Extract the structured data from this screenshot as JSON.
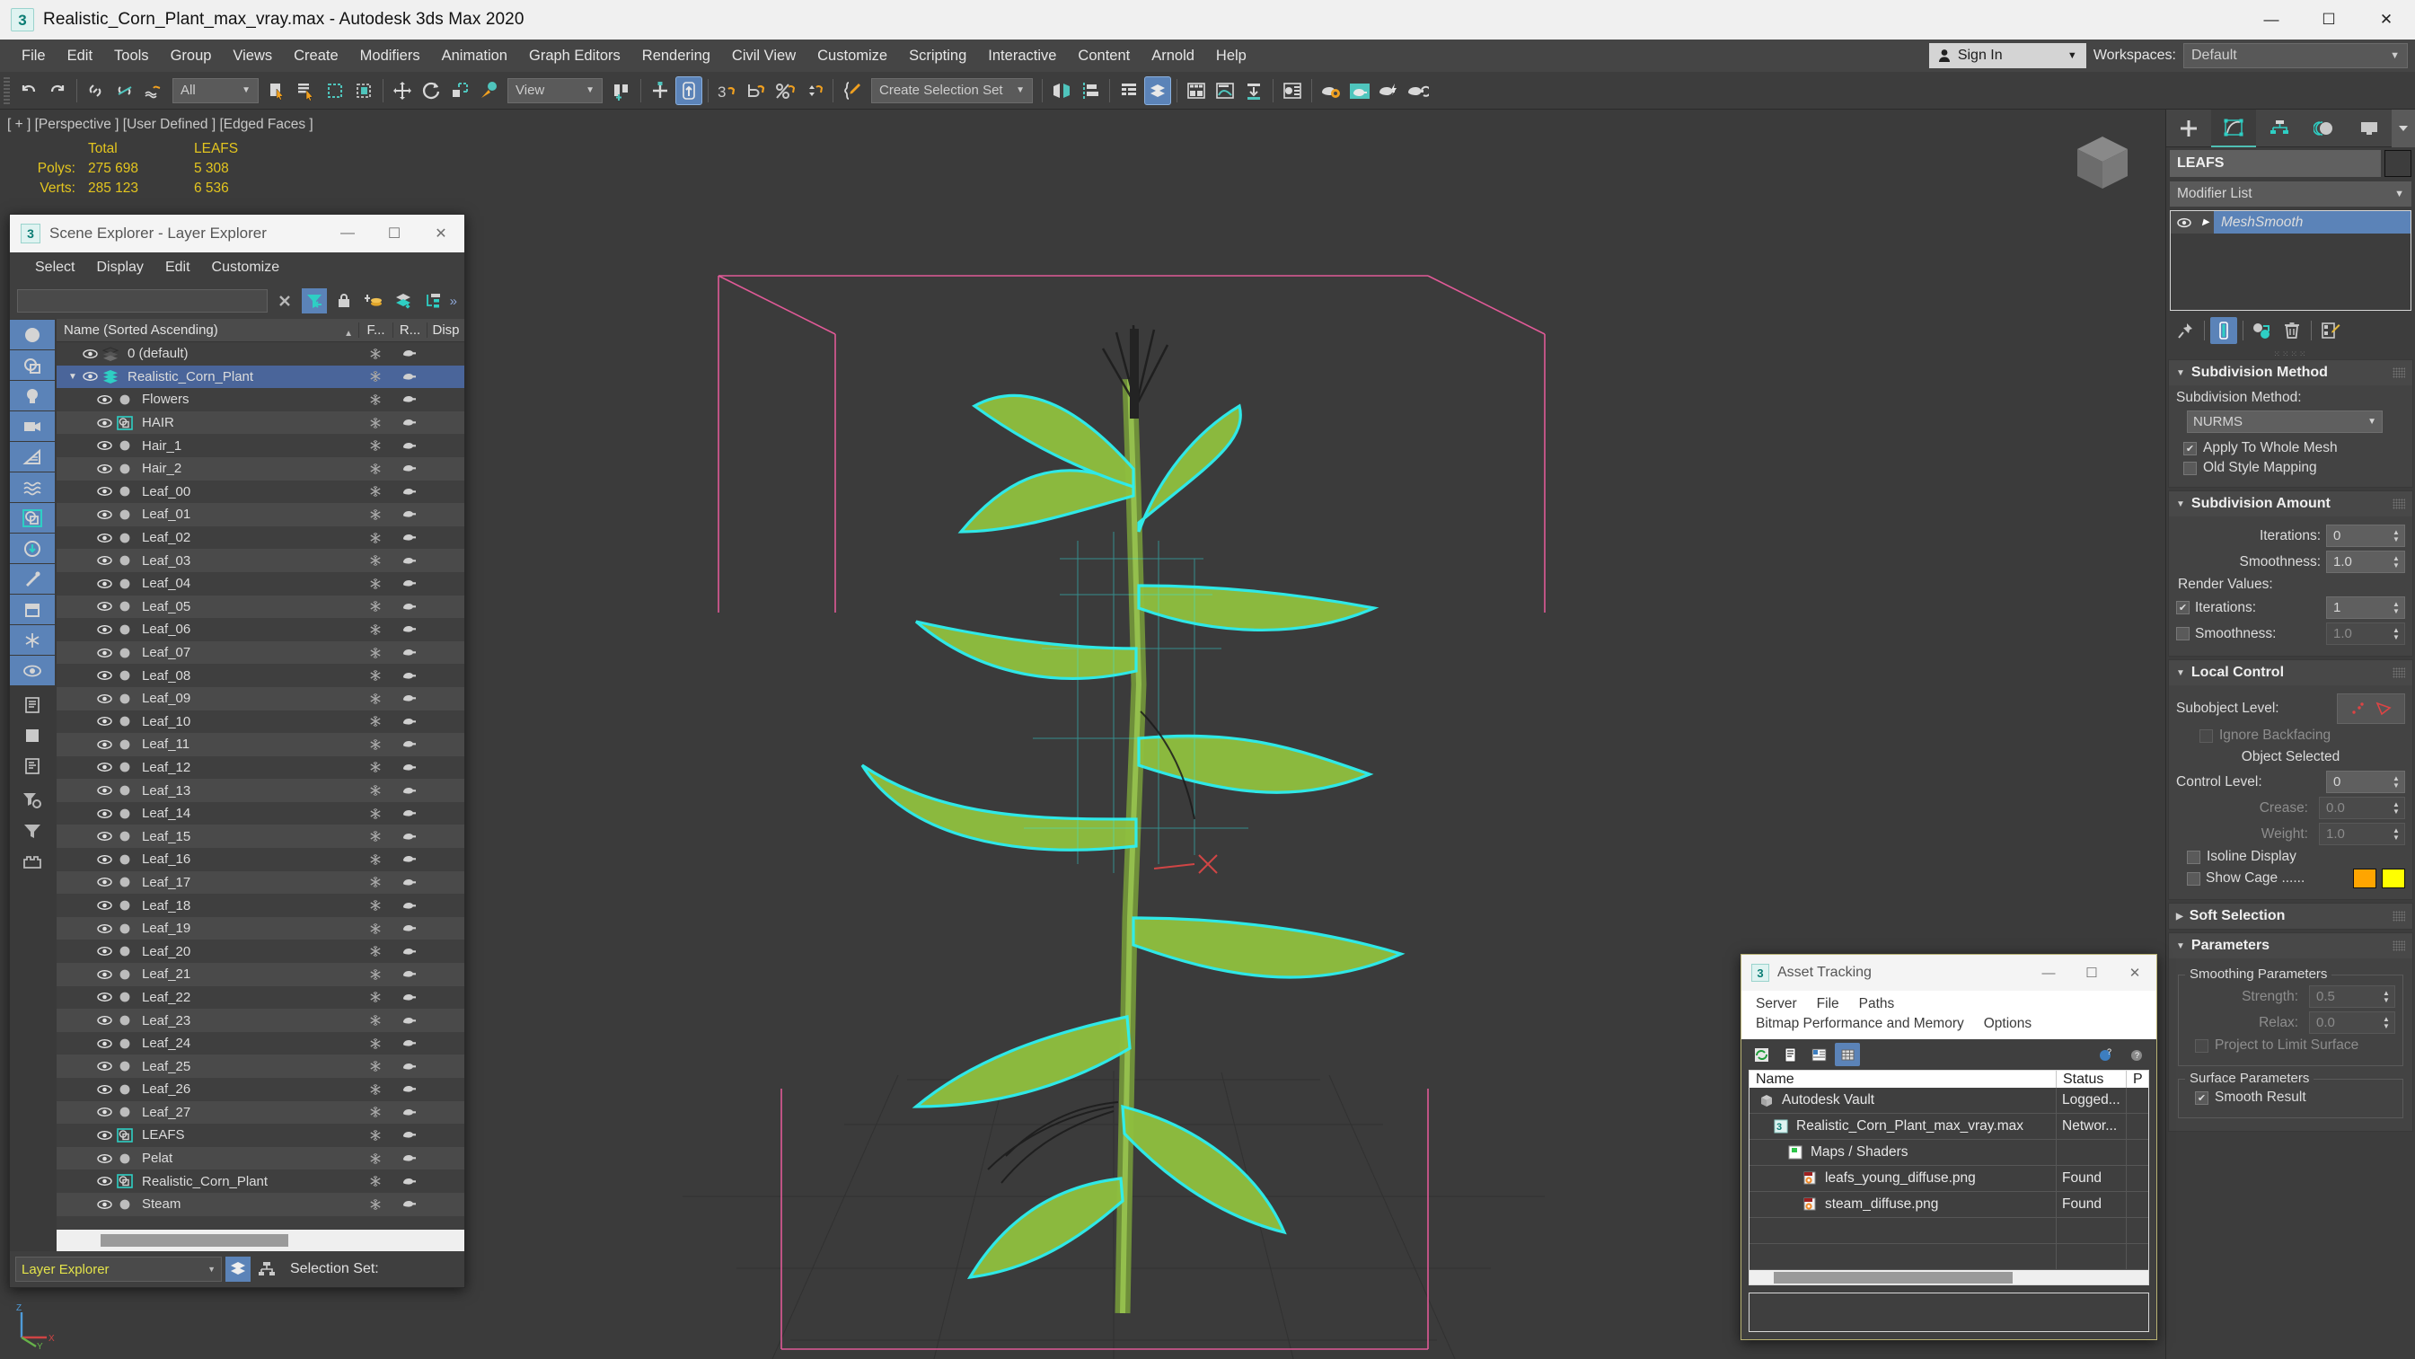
{
  "window": {
    "title": "Realistic_Corn_Plant_max_vray.max - Autodesk 3ds Max 2020",
    "app_icon": "3ds-max-icon",
    "minimize": "—",
    "maximize": "☐",
    "close": "✕"
  },
  "menubar": {
    "items": [
      "File",
      "Edit",
      "Tools",
      "Group",
      "Views",
      "Create",
      "Modifiers",
      "Animation",
      "Graph Editors",
      "Rendering",
      "Civil View",
      "Customize",
      "Scripting",
      "Interactive",
      "Content",
      "Arnold",
      "Help"
    ],
    "sign_in": "Sign In",
    "workspaces_label": "Workspaces:",
    "workspace_value": "Default",
    "caret": "▼"
  },
  "toolbar": {
    "selection_filter": "All",
    "reference_coord": "View",
    "selection_set": "Create Selection Set",
    "caret": "▼"
  },
  "viewport": {
    "label": "[ + ] [Perspective ] [User Defined ] [Edged Faces ]",
    "stats": {
      "col_total": "Total",
      "col_object": "LEAFS",
      "rows": [
        {
          "label": "Polys:",
          "total": "275 698",
          "object": "5 308"
        },
        {
          "label": "Verts:",
          "total": "285 123",
          "object": "6 536"
        }
      ]
    }
  },
  "scene_explorer": {
    "title": "Scene Explorer - Layer Explorer",
    "minimize": "—",
    "maximize": "☐",
    "close": "✕",
    "menus": [
      "Select",
      "Display",
      "Edit",
      "Customize"
    ],
    "search_value": "",
    "chevron": "»",
    "columns": {
      "name": "Name (Sorted Ascending)",
      "sort_arrow": "▲",
      "f": "F...",
      "r": "R...",
      "disp": "Disp"
    },
    "footer_combo": "Layer Explorer",
    "footer_selection_set": "Selection Set:",
    "rows": [
      {
        "name": "0 (default)",
        "indent": 1,
        "icon": "layers-icon",
        "selected": false,
        "expander": ""
      },
      {
        "name": "Realistic_Corn_Plant",
        "indent": 1,
        "icon": "layers-teal-icon",
        "selected": true,
        "expander": "▼"
      },
      {
        "name": "Flowers",
        "indent": 2,
        "icon": "sphere-icon",
        "selected": false,
        "expander": ""
      },
      {
        "name": "HAIR",
        "indent": 2,
        "icon": "group-icon",
        "selected": false,
        "expander": ""
      },
      {
        "name": "Hair_1",
        "indent": 2,
        "icon": "sphere-icon",
        "selected": false,
        "expander": ""
      },
      {
        "name": "Hair_2",
        "indent": 2,
        "icon": "sphere-icon",
        "selected": false,
        "expander": ""
      },
      {
        "name": "Leaf_00",
        "indent": 2,
        "icon": "sphere-icon",
        "selected": false,
        "expander": ""
      },
      {
        "name": "Leaf_01",
        "indent": 2,
        "icon": "sphere-icon",
        "selected": false,
        "expander": ""
      },
      {
        "name": "Leaf_02",
        "indent": 2,
        "icon": "sphere-icon",
        "selected": false,
        "expander": ""
      },
      {
        "name": "Leaf_03",
        "indent": 2,
        "icon": "sphere-icon",
        "selected": false,
        "expander": ""
      },
      {
        "name": "Leaf_04",
        "indent": 2,
        "icon": "sphere-icon",
        "selected": false,
        "expander": ""
      },
      {
        "name": "Leaf_05",
        "indent": 2,
        "icon": "sphere-icon",
        "selected": false,
        "expander": ""
      },
      {
        "name": "Leaf_06",
        "indent": 2,
        "icon": "sphere-icon",
        "selected": false,
        "expander": ""
      },
      {
        "name": "Leaf_07",
        "indent": 2,
        "icon": "sphere-icon",
        "selected": false,
        "expander": ""
      },
      {
        "name": "Leaf_08",
        "indent": 2,
        "icon": "sphere-icon",
        "selected": false,
        "expander": ""
      },
      {
        "name": "Leaf_09",
        "indent": 2,
        "icon": "sphere-icon",
        "selected": false,
        "expander": ""
      },
      {
        "name": "Leaf_10",
        "indent": 2,
        "icon": "sphere-icon",
        "selected": false,
        "expander": ""
      },
      {
        "name": "Leaf_11",
        "indent": 2,
        "icon": "sphere-icon",
        "selected": false,
        "expander": ""
      },
      {
        "name": "Leaf_12",
        "indent": 2,
        "icon": "sphere-icon",
        "selected": false,
        "expander": ""
      },
      {
        "name": "Leaf_13",
        "indent": 2,
        "icon": "sphere-icon",
        "selected": false,
        "expander": ""
      },
      {
        "name": "Leaf_14",
        "indent": 2,
        "icon": "sphere-icon",
        "selected": false,
        "expander": ""
      },
      {
        "name": "Leaf_15",
        "indent": 2,
        "icon": "sphere-icon",
        "selected": false,
        "expander": ""
      },
      {
        "name": "Leaf_16",
        "indent": 2,
        "icon": "sphere-icon",
        "selected": false,
        "expander": ""
      },
      {
        "name": "Leaf_17",
        "indent": 2,
        "icon": "sphere-icon",
        "selected": false,
        "expander": ""
      },
      {
        "name": "Leaf_18",
        "indent": 2,
        "icon": "sphere-icon",
        "selected": false,
        "expander": ""
      },
      {
        "name": "Leaf_19",
        "indent": 2,
        "icon": "sphere-icon",
        "selected": false,
        "expander": ""
      },
      {
        "name": "Leaf_20",
        "indent": 2,
        "icon": "sphere-icon",
        "selected": false,
        "expander": ""
      },
      {
        "name": "Leaf_21",
        "indent": 2,
        "icon": "sphere-icon",
        "selected": false,
        "expander": ""
      },
      {
        "name": "Leaf_22",
        "indent": 2,
        "icon": "sphere-icon",
        "selected": false,
        "expander": ""
      },
      {
        "name": "Leaf_23",
        "indent": 2,
        "icon": "sphere-icon",
        "selected": false,
        "expander": ""
      },
      {
        "name": "Leaf_24",
        "indent": 2,
        "icon": "sphere-icon",
        "selected": false,
        "expander": ""
      },
      {
        "name": "Leaf_25",
        "indent": 2,
        "icon": "sphere-icon",
        "selected": false,
        "expander": ""
      },
      {
        "name": "Leaf_26",
        "indent": 2,
        "icon": "sphere-icon",
        "selected": false,
        "expander": ""
      },
      {
        "name": "Leaf_27",
        "indent": 2,
        "icon": "sphere-icon",
        "selected": false,
        "expander": ""
      },
      {
        "name": "LEAFS",
        "indent": 2,
        "icon": "group-icon",
        "selected": false,
        "expander": ""
      },
      {
        "name": "Pelat",
        "indent": 2,
        "icon": "sphere-icon",
        "selected": false,
        "expander": ""
      },
      {
        "name": "Realistic_Corn_Plant",
        "indent": 2,
        "icon": "group-icon",
        "selected": false,
        "expander": ""
      },
      {
        "name": "Steam",
        "indent": 2,
        "icon": "sphere-icon",
        "selected": false,
        "expander": ""
      }
    ]
  },
  "asset_tracking": {
    "title": "Asset Tracking",
    "minimize": "—",
    "maximize": "☐",
    "close": "✕",
    "menus_row1": [
      "Server",
      "File",
      "Paths"
    ],
    "menus_row2": [
      "Bitmap Performance and Memory",
      "Options"
    ],
    "columns": {
      "name": "Name",
      "status": "Status",
      "p": "P"
    },
    "rows": [
      {
        "name": "Autodesk Vault",
        "status": "Logged...",
        "indent": 1,
        "icon": "vault-icon"
      },
      {
        "name": "Realistic_Corn_Plant_max_vray.max",
        "status": "Networ...",
        "indent": 2,
        "icon": "max-file-icon"
      },
      {
        "name": "Maps / Shaders",
        "status": "",
        "indent": 3,
        "icon": "maps-icon"
      },
      {
        "name": "leafs_young_diffuse.png",
        "status": "Found",
        "indent": 4,
        "icon": "png-file-icon"
      },
      {
        "name": "steam_diffuse.png",
        "status": "Found",
        "indent": 4,
        "icon": "png-file-icon"
      }
    ]
  },
  "command_panel": {
    "object_name": "LEAFS",
    "modifier_list": "Modifier List",
    "caret": "▼",
    "stack": [
      {
        "label": "MeshSmooth",
        "selected": true,
        "eye": "eye-icon",
        "tri": "▶"
      }
    ],
    "rollouts": {
      "subdivision_method": {
        "title": "Subdivision Method",
        "tri": "▼",
        "method_label": "Subdivision Method:",
        "method_value": "NURMS",
        "apply_whole_mesh": {
          "label": "Apply To Whole Mesh",
          "checked": true
        },
        "old_style_mapping": {
          "label": "Old Style Mapping",
          "checked": false
        }
      },
      "subdivision_amount": {
        "title": "Subdivision Amount",
        "tri": "▼",
        "iterations_label": "Iterations:",
        "iterations_value": "0",
        "smoothness_label": "Smoothness:",
        "smoothness_value": "1.0",
        "render_values_label": "Render Values:",
        "render_iterations_label": "Iterations:",
        "render_iterations_value": "1",
        "render_iterations_checked": true,
        "render_smoothness_label": "Smoothness:",
        "render_smoothness_value": "1.0",
        "render_smoothness_checked": false
      },
      "local_control": {
        "title": "Local Control",
        "tri": "▼",
        "subobject_label": "Subobject Level:",
        "ignore_backfacing": {
          "label": "Ignore Backfacing",
          "checked": false
        },
        "object_selected": "Object Selected",
        "control_level_label": "Control Level:",
        "control_level_value": "0",
        "crease_label": "Crease:",
        "crease_value": "0.0",
        "weight_label": "Weight:",
        "weight_value": "1.0",
        "isoline_display": {
          "label": "Isoline Display",
          "checked": false
        },
        "show_cage": {
          "label": "Show Cage ......",
          "checked": false
        },
        "cage_color_1": "#FFA500",
        "cage_color_2": "#FFFF00"
      },
      "soft_selection": {
        "title": "Soft Selection",
        "tri": "▶"
      },
      "parameters": {
        "title": "Parameters",
        "tri": "▼",
        "smoothing_legend": "Smoothing Parameters",
        "strength_label": "Strength:",
        "strength_value": "0.5",
        "relax_label": "Relax:",
        "relax_value": "0.0",
        "project_limit": {
          "label": "Project to Limit Surface",
          "checked": false
        },
        "surface_legend": "Surface Parameters",
        "smooth_result": {
          "label": "Smooth Result",
          "checked": true
        }
      }
    }
  }
}
